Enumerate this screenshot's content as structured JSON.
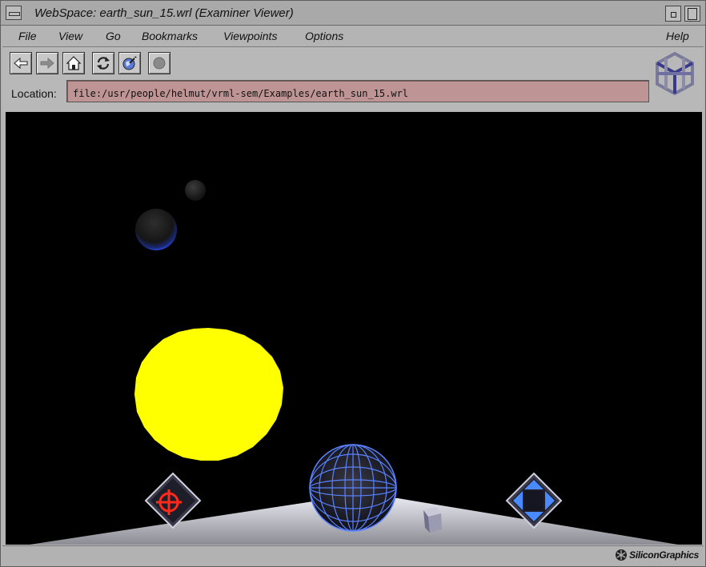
{
  "window": {
    "title": "WebSpace: earth_sun_15.wrl (Examiner Viewer)"
  },
  "menu": {
    "items": [
      {
        "id": "file",
        "label": "File"
      },
      {
        "id": "view",
        "label": "View"
      },
      {
        "id": "go",
        "label": "Go"
      },
      {
        "id": "bookmarks",
        "label": "Bookmarks"
      },
      {
        "id": "viewpoints",
        "label": "Viewpoints"
      },
      {
        "id": "options",
        "label": "Options"
      },
      {
        "id": "help",
        "label": "Help"
      }
    ]
  },
  "toolbar": {
    "buttons": [
      {
        "id": "back",
        "icon": "arrow-left-icon"
      },
      {
        "id": "forward",
        "icon": "arrow-right-icon"
      },
      {
        "id": "home",
        "icon": "home-icon"
      },
      {
        "id": "reload",
        "icon": "reload-icon"
      },
      {
        "id": "edit",
        "icon": "globe-pen-icon"
      },
      {
        "id": "stop",
        "icon": "stop-icon"
      }
    ],
    "location_label": "Location:",
    "location_value": "file:/usr/people/helmut/vrml-sem/Examples/earth_sun_15.wrl"
  },
  "viewer": {
    "controls": [
      "seek-target-icon",
      "trackball-sphere-icon",
      "pan-arrows-icon"
    ]
  },
  "status": {
    "brand": "SiliconGraphics"
  },
  "colors": {
    "sun": "#ffff00",
    "location_field": "#bf9494",
    "viewer_background": "#000000",
    "trackball": "#5a82ff"
  }
}
